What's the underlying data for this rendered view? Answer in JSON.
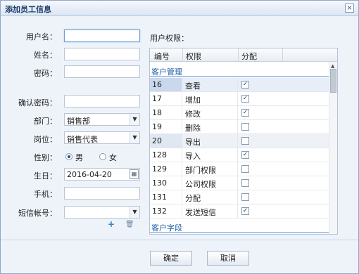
{
  "dialog": {
    "title": "添加员工信息",
    "close": "×"
  },
  "form": {
    "username_label": "用户名：",
    "name_label": "姓名：",
    "password_label": "密码：",
    "confirm_label": "确认密码：",
    "dept_label": "部门：",
    "dept_value": "销售部",
    "position_label": "岗位：",
    "position_value": "销售代表",
    "gender_label": "性别：",
    "gender_male": "男",
    "gender_female": "女",
    "gender_selected": "男",
    "birthday_label": "生日：",
    "birthday_value": "2016-04-20",
    "phone_label": "手机：",
    "sms_label": "短信帐号：",
    "sms_value": ""
  },
  "permissions": {
    "title": "用户权限：",
    "columns": [
      "编号",
      "权限",
      "分配"
    ],
    "group1": "客户管理",
    "group2": "客户字段",
    "rows": [
      {
        "id": "16",
        "name": "查看",
        "checked": true
      },
      {
        "id": "17",
        "name": "增加",
        "checked": true
      },
      {
        "id": "18",
        "name": "修改",
        "checked": true
      },
      {
        "id": "19",
        "name": "删除",
        "checked": false
      },
      {
        "id": "20",
        "name": "导出",
        "checked": false
      },
      {
        "id": "128",
        "name": "导入",
        "checked": true
      },
      {
        "id": "129",
        "name": "部门权限",
        "checked": false
      },
      {
        "id": "130",
        "name": "公司权限",
        "checked": false
      },
      {
        "id": "131",
        "name": "分配",
        "checked": false
      },
      {
        "id": "132",
        "name": "发送短信",
        "checked": true
      }
    ]
  },
  "buttons": {
    "ok": "确定",
    "cancel": "取消"
  },
  "icons": {
    "add": "+",
    "delete": "🗑"
  }
}
